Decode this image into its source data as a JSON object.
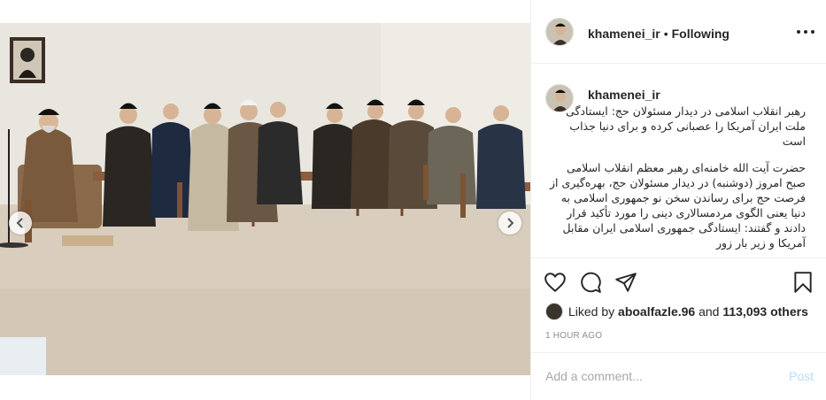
{
  "post": {
    "author": "khamenei_ir",
    "follow_status": "Following",
    "separator": "•",
    "caption_author": "khamenei_ir",
    "caption_paragraphs": [
      "رهبر انقلاب اسلامی در دیدار مسئولان حج: ایستادگی ملت ایران آمریکا را عصبانی کرده و برای دنیا جذاب است",
      "حضرت آیت الله خامنه‌ای رهبر معظم انقلاب اسلامی صبح امروز (دوشنبه) در دیدار مسئولان حج، بهره‌گیری از فرصت حج برای رساندن سخن نو جمهوری اسلامی به دنیا یعنی الگوی مردمسالاری دینی را مورد تأکید قرار دادند و گفتند: ایستادگی جمهوری اسلامی ایران مقابل آمریکا و زیر بار زور"
    ],
    "likes_prefix": "Liked by",
    "liked_by_user": "aboalfazle.96",
    "likes_joiner": "and",
    "likes_others": "113,093 others",
    "time_ago": "1 HOUR AGO",
    "comment_placeholder": "Add a comment...",
    "post_label": "Post"
  },
  "carousel": {
    "slide_count": 9,
    "active_index": 7
  },
  "icons": {
    "more": "more-options-icon",
    "like": "heart-icon",
    "comment": "comment-icon",
    "share": "share-icon",
    "save": "bookmark-icon",
    "prev": "chevron-left-icon",
    "next": "chevron-right-icon"
  },
  "colors": {
    "text": "#262626",
    "muted": "#8e8e8e",
    "post_disabled": "#b2dffc",
    "border": "#efefef"
  }
}
